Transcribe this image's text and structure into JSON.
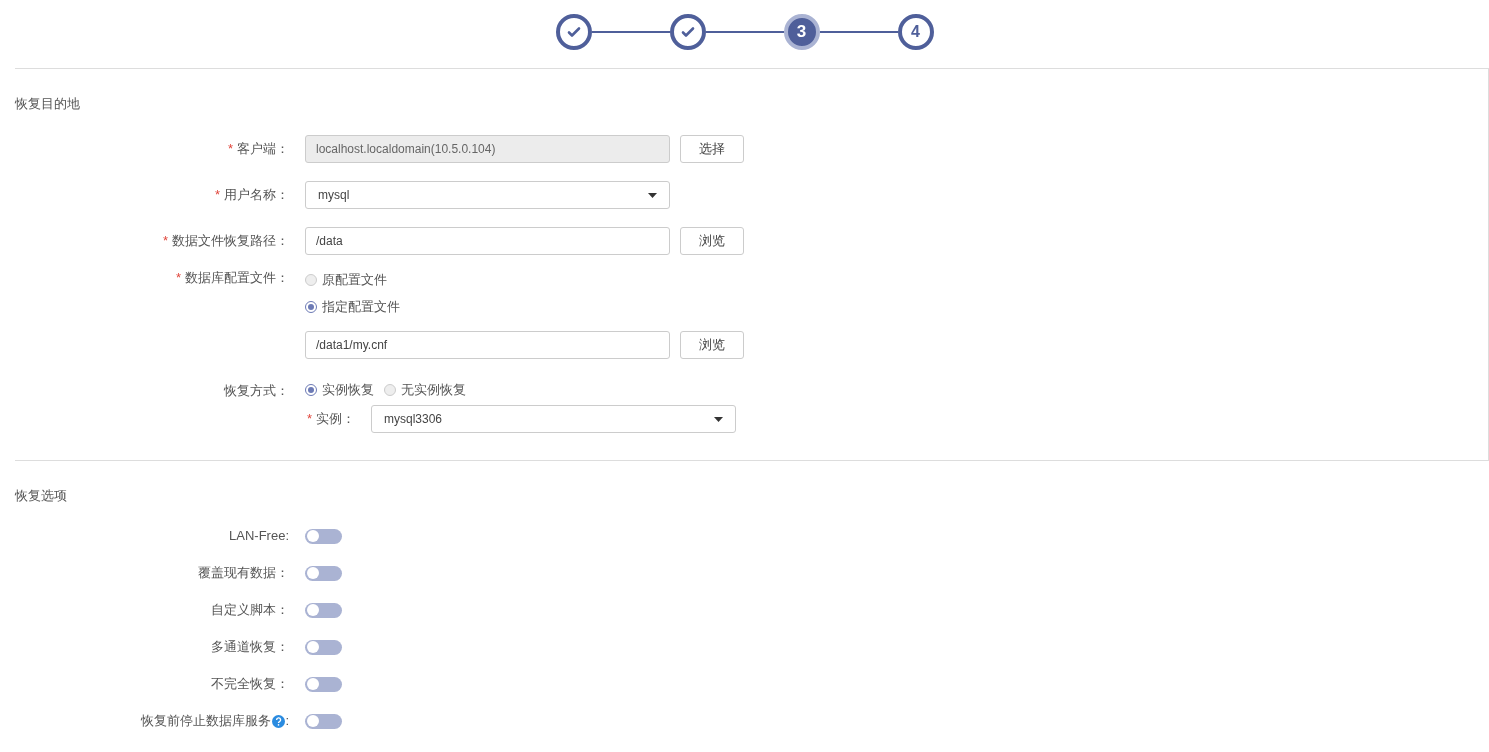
{
  "steps": [
    {
      "completed": true,
      "selected": false
    },
    {
      "completed": true,
      "selected": false
    },
    {
      "completed": false,
      "selected": true,
      "label": "3"
    },
    {
      "completed": false,
      "selected": false,
      "label": "4"
    }
  ],
  "destination": {
    "title": "恢复目的地",
    "client": {
      "label": "客户端：",
      "required_mark": "*",
      "value": "localhost.localdomain(10.5.0.104)",
      "disabled": true,
      "button": "选择"
    },
    "username": {
      "label": "用户名称：",
      "required_mark": "*",
      "value": "mysql"
    },
    "data_path": {
      "label": "数据文件恢复路径：",
      "required_mark": "*",
      "value": "/data",
      "button": "浏览"
    },
    "config": {
      "label": "数据库配置文件：",
      "required_mark": "*",
      "options": [
        {
          "label": "原配置文件",
          "selected": false
        },
        {
          "label": "指定配置文件",
          "selected": true
        }
      ],
      "value": "/data1/my.cnf",
      "button": "浏览"
    },
    "mode": {
      "label": "恢复方式：",
      "options": [
        {
          "label": "实例恢复",
          "selected": true
        },
        {
          "label": "无实例恢复",
          "selected": false
        }
      ],
      "instance_label": "实例：",
      "instance_required_mark": "*",
      "instance_value": "mysql3306"
    }
  },
  "options": {
    "title": "恢复选项",
    "items": [
      {
        "label": "LAN-Free:",
        "on": false,
        "help": false
      },
      {
        "label": "覆盖现有数据：",
        "on": false,
        "help": false
      },
      {
        "label": "自定义脚本：",
        "on": false,
        "help": false
      },
      {
        "label": "多通道恢复：",
        "on": false,
        "help": false
      },
      {
        "label": "不完全恢复：",
        "on": false,
        "help": false
      },
      {
        "label": "恢复前停止数据库服务",
        "on": false,
        "help": true,
        "suffix": ":"
      }
    ]
  }
}
